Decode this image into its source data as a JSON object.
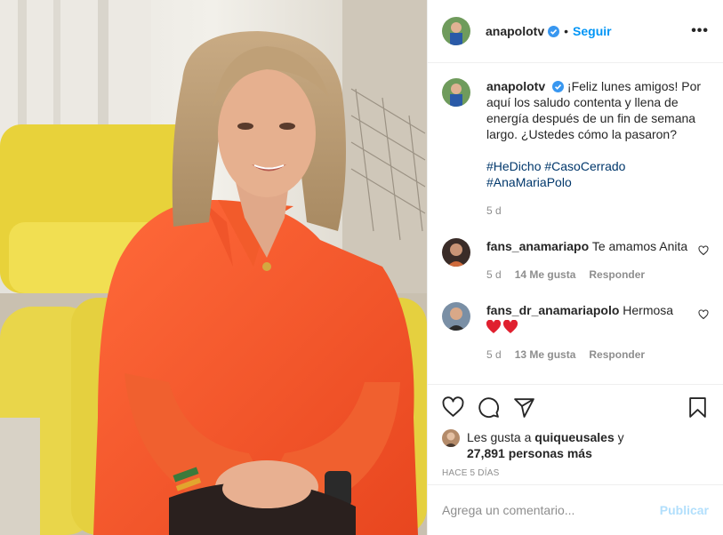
{
  "header": {
    "username": "anapolotv",
    "separator": "•",
    "follow_label": "Seguir",
    "more_label": "•••"
  },
  "caption": {
    "username": "anapolotv",
    "text": "¡Feliz lunes amigos! Por aquí los saludo contenta y llena de energía después de un fin de semana largo. ¿Ustedes cómo la pasaron?",
    "hashtags": [
      "#HeDicho",
      "#CasoCerrado",
      "#AnaMariaPolo"
    ],
    "age": "5 d"
  },
  "comments": [
    {
      "username": "fans_anamariapo",
      "text": "Te amamos Anita",
      "age": "5 d",
      "likes": "14 Me gusta",
      "reply_label": "Responder"
    },
    {
      "username": "fans_dr_anamariapolo",
      "text": "Hermosa",
      "age": "5 d",
      "likes": "13 Me gusta",
      "reply_label": "Responder"
    }
  ],
  "likes": {
    "prefix": "Les gusta a",
    "user": "quiqueusales",
    "connector": "y",
    "others": "27,891 personas más"
  },
  "time_ago": "HACE 5 DÍAS",
  "add_comment": {
    "placeholder": "Agrega un comentario...",
    "publish_label": "Publicar"
  },
  "icons": {
    "like": "heart-icon",
    "comment": "comment-icon",
    "share": "share-icon",
    "save": "bookmark-icon",
    "verified": "verified-badge-icon"
  },
  "colors": {
    "link_blue": "#0095f6",
    "hashtag": "#00376b",
    "muted": "#8e8e8e",
    "verified": "#3897f0",
    "heart_red": "#ed4956",
    "publish_disabled": "#b2dffc"
  }
}
